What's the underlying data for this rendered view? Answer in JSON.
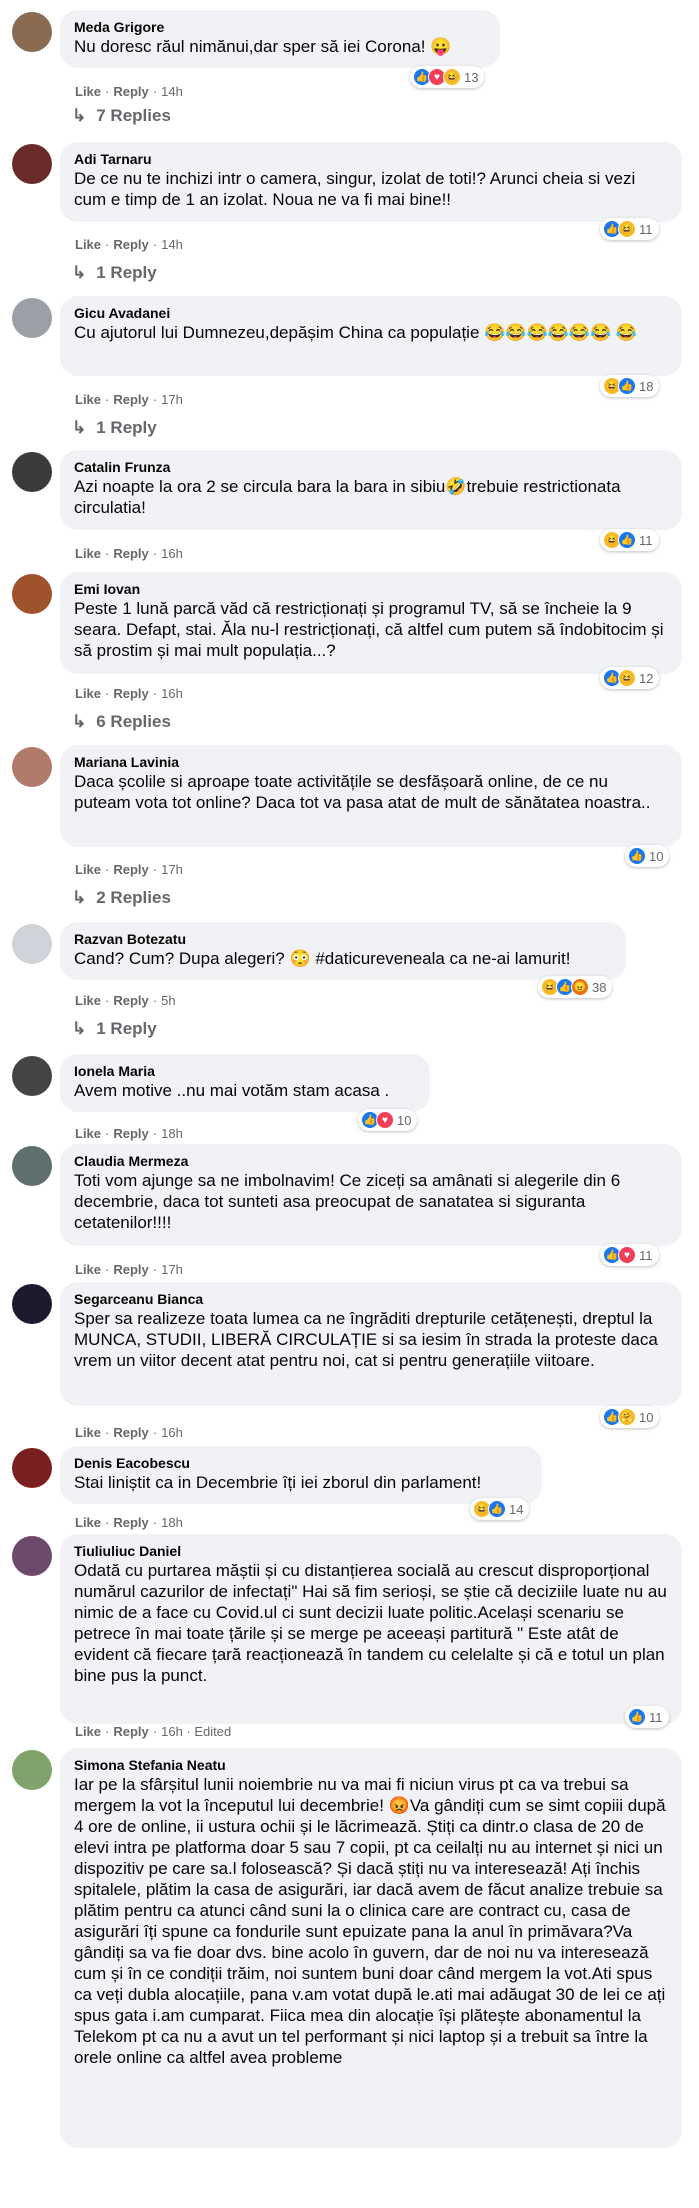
{
  "comments": [
    {
      "author": "Meda Grigore",
      "text": "Nu doresc răul nimănui,dar sper să iei Corona! 😛",
      "like_label": "Like",
      "reply_label": "Reply",
      "time": "14h",
      "reaction_icons": [
        "like",
        "love",
        "haha"
      ],
      "reaction_count": "13",
      "replies_label": "7 Replies"
    },
    {
      "author": "Adi Tarnaru",
      "text": "De ce nu te inchizi intr o camera, singur, izolat de toti!? Arunci cheia si vezi cum e timp de 1 an izolat. Noua ne va fi mai bine!!",
      "like_label": "Like",
      "reply_label": "Reply",
      "time": "14h",
      "reaction_icons": [
        "like",
        "haha"
      ],
      "reaction_count": "11",
      "replies_label": "1 Reply"
    },
    {
      "author": "Gicu Avadanei",
      "text": "Cu ajutorul lui Dumnezeu,depășim China ca populație 😂😂😂😂😂😂 😂",
      "like_label": "Like",
      "reply_label": "Reply",
      "time": "17h",
      "reaction_icons": [
        "haha",
        "like"
      ],
      "reaction_count": "18",
      "replies_label": "1 Reply"
    },
    {
      "author": "Catalin Frunza",
      "text": "Azi noapte la ora 2 se circula bara la bara in sibiu🤣trebuie restrictionata circulatia!",
      "like_label": "Like",
      "reply_label": "Reply",
      "time": "16h",
      "reaction_icons": [
        "haha",
        "like"
      ],
      "reaction_count": "11",
      "replies_label": ""
    },
    {
      "author": "Emi Iovan",
      "text": "Peste 1 lună parcă văd că restricționați și programul TV, să se încheie la 9 seara. Defapt, stai. Ăla nu-l restricționați, că altfel cum putem să îndobitocim și să prostim și mai mult populația...?",
      "like_label": "Like",
      "reply_label": "Reply",
      "time": "16h",
      "reaction_icons": [
        "like",
        "haha"
      ],
      "reaction_count": "12",
      "replies_label": "6 Replies"
    },
    {
      "author": "Mariana Lavinia",
      "text": "Daca școlile si aproape toate activitățile se desfășoară online, de ce nu puteam vota tot online? Daca tot va pasa atat de mult de sănătatea noastra..",
      "like_label": "Like",
      "reply_label": "Reply",
      "time": "17h",
      "reaction_icons": [
        "like"
      ],
      "reaction_count": "10",
      "replies_label": "2 Replies"
    },
    {
      "author": "Razvan Botezatu",
      "text": "Cand? Cum? Dupa alegeri? 😳 #daticureveneala ca ne-ai lamurit!",
      "like_label": "Like",
      "reply_label": "Reply",
      "time": "5h",
      "reaction_icons": [
        "haha",
        "like",
        "angry"
      ],
      "reaction_count": "38",
      "replies_label": "1 Reply"
    },
    {
      "author": "Ionela Maria",
      "text": "Avem motive ..nu mai votăm stam acasa .",
      "like_label": "Like",
      "reply_label": "Reply",
      "time": "18h",
      "reaction_icons": [
        "like",
        "love"
      ],
      "reaction_count": "10",
      "replies_label": ""
    },
    {
      "author": "Claudia Mermeza",
      "text": "Toti vom ajunge sa ne imbolnavim! Ce ziceți sa amânati si alegerile din 6 decembrie, daca tot sunteti asa preocupat de sanatatea si siguranta cetatenilor!!!!",
      "like_label": "Like",
      "reply_label": "Reply",
      "time": "17h",
      "reaction_icons": [
        "like",
        "love"
      ],
      "reaction_count": "11",
      "replies_label": ""
    },
    {
      "author": "Segarceanu Bianca",
      "text": "Sper sa realizeze toata lumea ca ne îngrăditi drepturile cetățenești, dreptul la MUNCA, STUDII, LIBERĂ CIRCULAȚIE si sa iesim în strada la proteste daca vrem un viitor decent atat pentru noi, cat si pentru generațiile viitoare.",
      "like_label": "Like",
      "reply_label": "Reply",
      "time": "16h",
      "reaction_icons": [
        "like",
        "care"
      ],
      "reaction_count": "10",
      "replies_label": ""
    },
    {
      "author": "Denis Eacobescu",
      "text": "Stai liniștit ca in Decembrie îți iei zborul din parlament!",
      "like_label": "Like",
      "reply_label": "Reply",
      "time": "18h",
      "reaction_icons": [
        "haha",
        "like"
      ],
      "reaction_count": "14",
      "replies_label": ""
    },
    {
      "author": "Tiuliuliuc Daniel",
      "text": "Odată cu purtarea măștii și cu distanțierea socială au crescut disproporțional numărul cazurilor de infectați\" Hai să fim serioși, se știe că deciziile luate nu au nimic de a face cu Covid.ul ci sunt decizii luate politic.Același scenariu se petrece în mai toate țările și se merge pe aceeași partitură \" Este atât de evident că fiecare țară reacționează în tandem cu celelalte și că e totul un plan bine pus la punct.",
      "like_label": "Like",
      "reply_label": "Reply",
      "time": "16h · Edited",
      "reaction_icons": [
        "like"
      ],
      "reaction_count": "11",
      "replies_label": ""
    },
    {
      "author": "Simona Stefania Neatu",
      "text": "Iar pe la sfârșitul lunii noiembrie nu va mai fi niciun virus pt ca va trebui sa mergem la vot la începutul lui decembrie! 😡Va gândiți cum se simt copiii după 4 ore de online, ii ustura ochii și le lăcrimează. Știți ca dintr.o clasa de 20 de elevi intra pe platforma doar 5 sau 7 copii, pt ca ceilalți nu au internet și nici un dispozitiv pe care sa.l folosească? Și dacă știți nu va interesează! Ați închis spitalele, plătim la casa de asigurări, iar dacă avem de făcut analize trebuie sa plătim pentru ca atunci când suni la o clinica care are contract cu, casa de asigurări îți spune ca fondurile sunt epuizate pana la anul în primăvara?Va gândiți sa va fie doar dvs. bine acolo în guvern, dar de noi nu va interesează cum și în ce condiții trăim, noi suntem buni doar când mergem la vot.Ati spus ca veți dubla alocațiile, pana v.am votat după le.ati mai adăugat 30 de lei ce ați spus gata i.am cumparat. Fiica mea din alocație își plătește abonamentul la Telekom pt ca nu a avut un tel performant și nici laptop și a trebuit sa între la orele online ca altfel avea probleme",
      "like_label": "",
      "reply_label": "",
      "time": "",
      "reaction_icons": [],
      "reaction_count": "",
      "replies_label": ""
    }
  ],
  "colors": {
    "bubble": "#f0f2f5",
    "secondary_text": "#65676b",
    "like_blue": "#1877f2",
    "love_red": "#f33e58",
    "haha_yellow": "#f7b928",
    "angry_orange": "#e9710f"
  }
}
